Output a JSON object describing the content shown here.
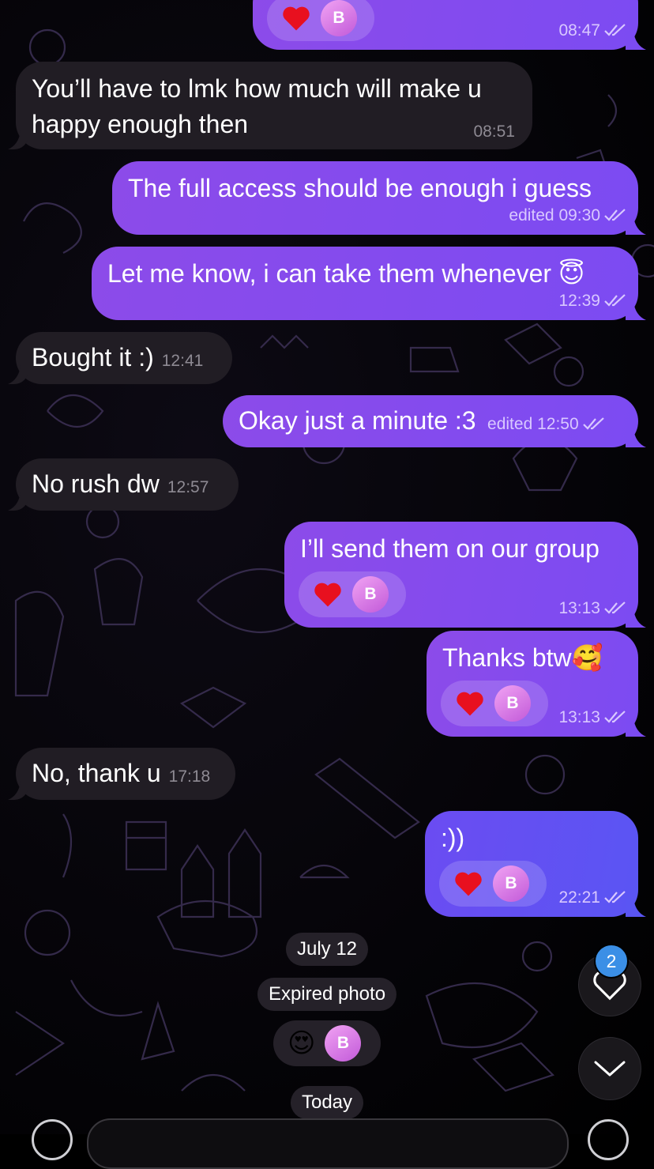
{
  "messages": [
    {
      "id": "m0",
      "dir": "out",
      "text": "",
      "time": "08:47"
    },
    {
      "id": "m1",
      "dir": "in",
      "lines": [
        "You’ll have to lmk how much will make u",
        "happy enough then"
      ],
      "time": "08:51"
    },
    {
      "id": "m2",
      "dir": "out",
      "text": "The full access should be enough i guess",
      "time": "edited 09:30"
    },
    {
      "id": "m3",
      "dir": "out",
      "text": "Let me know, i can take them whenever 😇",
      "time": "12:39"
    },
    {
      "id": "m4",
      "dir": "in",
      "text": "Bought it :)",
      "time": "12:41"
    },
    {
      "id": "m5",
      "dir": "out",
      "text": "Okay just a minute :3",
      "time": "edited 12:50"
    },
    {
      "id": "m6",
      "dir": "in",
      "text": "No rush dw",
      "time": "12:57"
    },
    {
      "id": "m7",
      "dir": "out",
      "text": "I’ll send them on our group",
      "time": "13:13"
    },
    {
      "id": "m8",
      "dir": "out",
      "text": "Thanks btw🥰",
      "time": "13:13"
    },
    {
      "id": "m9",
      "dir": "in",
      "text": "No, thank u",
      "time": "17:18"
    },
    {
      "id": "m10",
      "dir": "out",
      "text": ":))",
      "time": "22:21"
    }
  ],
  "reaction": {
    "emoji": "❤️",
    "avatar_initial": "B"
  },
  "date_separator": "July 12",
  "expired_photo": "Expired photo",
  "expired_reaction": {
    "emoji": "😍",
    "avatar_initial": "B"
  },
  "today_separator": "Today",
  "unread_reactions_count": "2",
  "colors": {
    "outgoing": "#7c4bf2",
    "incoming": "#211d24",
    "badge": "#3b8fe6",
    "heart": "#e8101f"
  }
}
